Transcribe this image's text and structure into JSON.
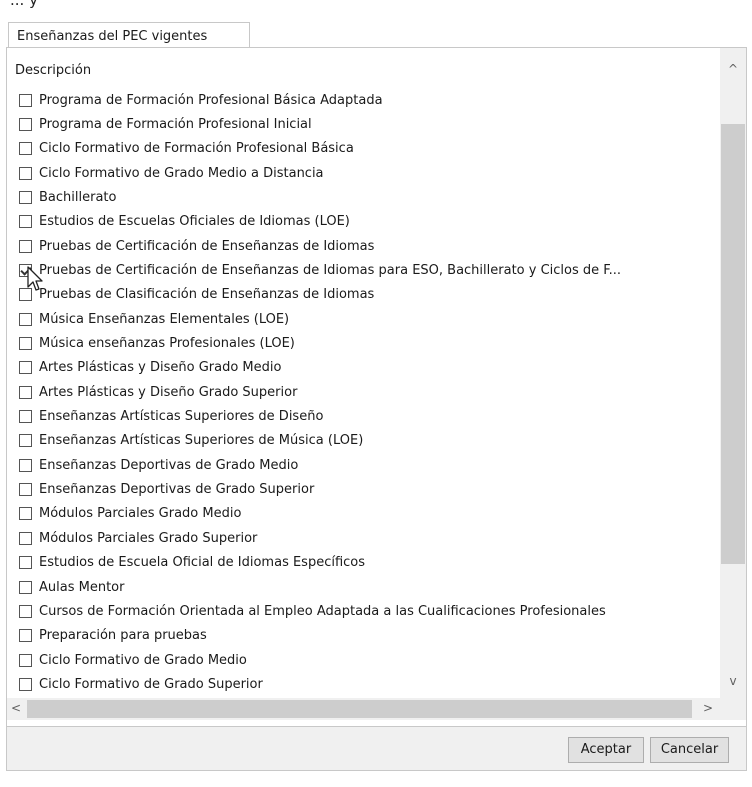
{
  "top_cut_text": "... y",
  "tab": {
    "label": "Enseñanzas del PEC vigentes"
  },
  "list": {
    "header": "Descripción",
    "items": [
      {
        "label": "Programa de Formación Profesional Básica Adaptada",
        "checked": false
      },
      {
        "label": "Programa de Formación Profesional Inicial",
        "checked": false
      },
      {
        "label": "Ciclo Formativo de Formación Profesional Básica",
        "checked": false
      },
      {
        "label": "Ciclo Formativo de Grado Medio a Distancia",
        "checked": false
      },
      {
        "label": "Bachillerato",
        "checked": false
      },
      {
        "label": "Estudios de Escuelas Oficiales de Idiomas (LOE)",
        "checked": false
      },
      {
        "label": "Pruebas de Certificación de Enseñanzas de Idiomas",
        "checked": false
      },
      {
        "label": "Pruebas de Certificación de Enseñanzas de Idiomas para ESO, Bachillerato y Ciclos de F...",
        "checked": true
      },
      {
        "label": "Pruebas de Clasificación de Enseñanzas de Idiomas",
        "checked": false
      },
      {
        "label": "Música Enseñanzas Elementales (LOE)",
        "checked": false
      },
      {
        "label": "Música enseñanzas Profesionales (LOE)",
        "checked": false
      },
      {
        "label": "Artes Plásticas y Diseño Grado Medio",
        "checked": false
      },
      {
        "label": "Artes Plásticas y Diseño Grado Superior",
        "checked": false
      },
      {
        "label": "Enseñanzas Artísticas Superiores de Diseño",
        "checked": false
      },
      {
        "label": "Enseñanzas Artísticas Superiores de Música (LOE)",
        "checked": false
      },
      {
        "label": "Enseñanzas Deportivas de Grado Medio",
        "checked": false
      },
      {
        "label": "Enseñanzas Deportivas de Grado Superior",
        "checked": false
      },
      {
        "label": "Módulos Parciales Grado Medio",
        "checked": false
      },
      {
        "label": "Módulos Parciales Grado Superior",
        "checked": false
      },
      {
        "label": "Estudios de Escuela Oficial de Idiomas Específicos",
        "checked": false
      },
      {
        "label": "Aulas Mentor",
        "checked": false
      },
      {
        "label": "Cursos de Formación Orientada al Empleo Adaptada a las Cualificaciones Profesionales",
        "checked": false
      },
      {
        "label": "Preparación para pruebas",
        "checked": false
      },
      {
        "label": "Ciclo Formativo de Grado Medio",
        "checked": false
      },
      {
        "label": "Ciclo Formativo de Grado Superior",
        "checked": false
      }
    ]
  },
  "scroll": {
    "up": "^",
    "down": "v",
    "left": "<",
    "right": ">"
  },
  "buttons": {
    "accept": "Aceptar",
    "cancel": "Cancelar"
  }
}
